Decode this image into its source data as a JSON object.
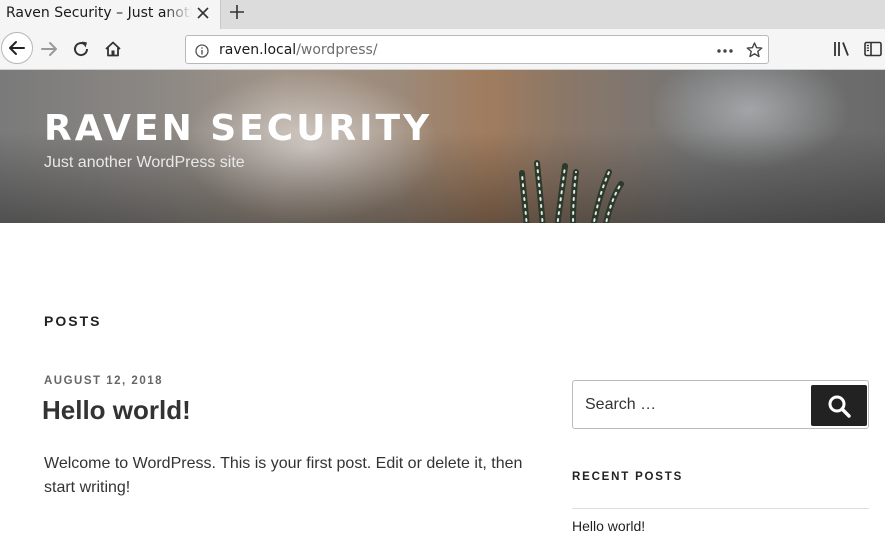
{
  "browser": {
    "tab_title": "Raven Security – Just another WordPress site",
    "url": {
      "host": "raven.local",
      "path": "/wordpress/"
    }
  },
  "site": {
    "title": "RAVEN SECURITY",
    "description": "Just another WordPress site"
  },
  "main": {
    "section_heading": "POSTS",
    "posts": [
      {
        "date": "AUGUST 12, 2018",
        "title": "Hello world!",
        "excerpt": "Welcome to WordPress. This is your first post. Edit or delete it, then start writing!"
      }
    ]
  },
  "sidebar": {
    "search": {
      "placeholder": "Search …"
    },
    "recent_posts": {
      "heading": "RECENT POSTS",
      "items": [
        "Hello world!"
      ]
    }
  },
  "icons": {
    "tab_close": "close-icon",
    "new_tab": "plus-icon",
    "back": "arrow-left-icon",
    "forward": "arrow-right-icon",
    "reload": "reload-icon",
    "home": "home-icon",
    "site_info": "info-icon",
    "page_actions": "more-dots-icon",
    "bookmark": "star-icon",
    "library": "library-icon",
    "sidebar": "sidebar-icon",
    "search": "search-icon"
  }
}
